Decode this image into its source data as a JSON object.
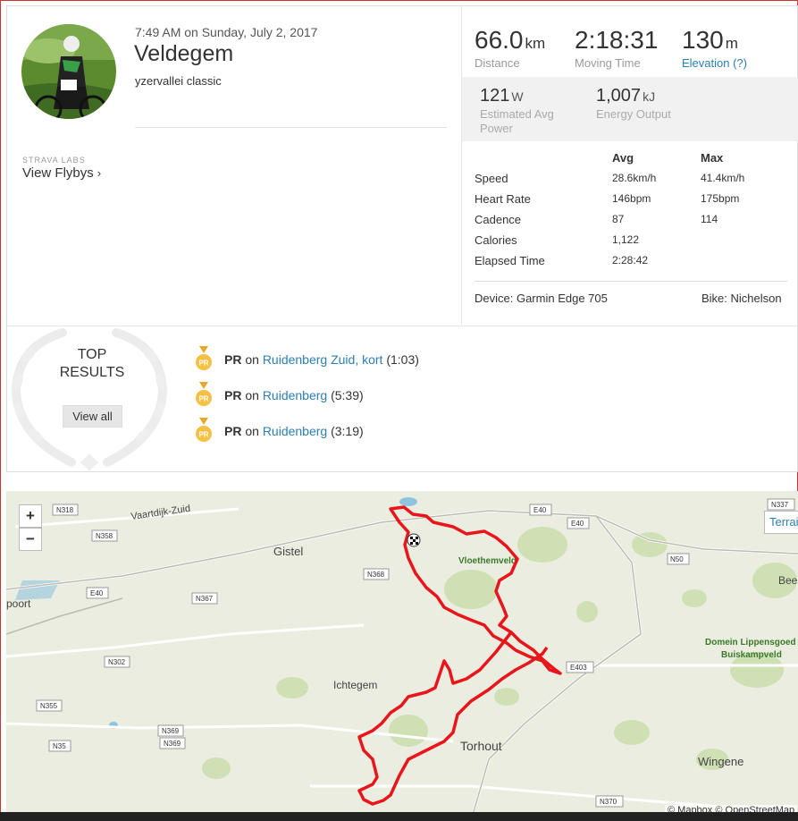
{
  "activity": {
    "datetime": "7:49 AM on Sunday, July 2, 2017",
    "title": "Veldegem",
    "description": "yzervallei classic"
  },
  "labs": {
    "small": "STRAVA LABS",
    "link": "View Flybys",
    "chevron": "›"
  },
  "stats": {
    "distance": {
      "value": "66.0",
      "unit": "km",
      "label": "Distance"
    },
    "moving_time": {
      "value": "2:18:31",
      "label": "Moving Time"
    },
    "elevation": {
      "value": "130",
      "unit": "m",
      "label": "Elevation (?)"
    },
    "power": {
      "value": "121",
      "unit": "W",
      "label_1": "Estimated Avg",
      "label_2": "Power"
    },
    "energy": {
      "value": "1,007",
      "unit": "kJ",
      "label": "Energy Output"
    }
  },
  "table": {
    "headers": {
      "avg": "Avg",
      "max": "Max"
    },
    "rows": [
      {
        "label": "Speed",
        "avg": "28.6km/h",
        "max": "41.4km/h"
      },
      {
        "label": "Heart Rate",
        "avg": "146bpm",
        "max": "175bpm"
      },
      {
        "label": "Cadence",
        "avg": "87",
        "max": "114"
      },
      {
        "label": "Calories",
        "avg": "1,122",
        "max": ""
      },
      {
        "label": "Elapsed Time",
        "avg": "2:28:42",
        "max": ""
      }
    ]
  },
  "device": "Device: Garmin Edge 705",
  "bike": "Bike: Nichelson",
  "top_results": {
    "label_1": "TOP",
    "label_2": "RESULTS",
    "view_all": "View all",
    "items": [
      {
        "badge": "PR",
        "pr": "PR",
        "on": "on",
        "segment": "Ruidenberg Zuid, kort",
        "time": "(1:03)"
      },
      {
        "badge": "PR",
        "pr": "PR",
        "on": "on",
        "segment": "Ruidenberg",
        "time": "(5:39)"
      },
      {
        "badge": "PR",
        "pr": "PR",
        "on": "on",
        "segment": "Ruidenberg",
        "time": "(3:19)"
      }
    ]
  },
  "map": {
    "zoom_in": "+",
    "zoom_out": "−",
    "terrain": "Terrain",
    "attribution": "© Mapbox © OpenStreetMap",
    "places": [
      "Gistel",
      "Vloethemveld",
      "Ichtegem",
      "Torhout",
      "Wingene",
      "Domein Lippensgoed",
      "Buiskampveld",
      "poort",
      "Bee",
      "Vaartdijk-Zuid"
    ],
    "roads": [
      "N318",
      "N358",
      "E40",
      "N367",
      "N368",
      "N302",
      "N355",
      "N369",
      "N369",
      "N35",
      "E40",
      "E40",
      "N50",
      "E403",
      "N370",
      "N337"
    ]
  },
  "colors": {
    "link": "#2b7fb3",
    "route": "#e8151b",
    "medal": "#f5c043",
    "frame": "#cc3333"
  }
}
